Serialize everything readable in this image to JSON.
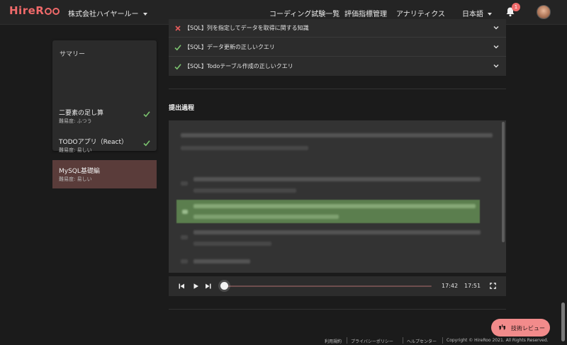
{
  "header": {
    "logo": "HireRoo",
    "company": "株式会社ハイヤールー",
    "nav": [
      "コーディング試験一覧",
      "評価指標管理",
      "アナリティクス"
    ],
    "language": "日本語",
    "notification_count": "1"
  },
  "summary": {
    "title": "サマリー",
    "items": [
      {
        "name": "二要素の足し算",
        "difficulty": "難易度: ふつう",
        "status": "passed"
      },
      {
        "name": "TODOアプリ（React）",
        "difficulty": "難易度: 易しい",
        "status": "passed"
      },
      {
        "name": "MySQL基礎編",
        "difficulty": "難易度: 易しい",
        "status": "selected"
      }
    ]
  },
  "questions": [
    {
      "label": "【SQL】列を指定してデータを取得に関する知識",
      "result": "incorrect"
    },
    {
      "label": "【SQL】データ更新の正しいクエリ",
      "result": "correct"
    },
    {
      "label": "【SQL】Todoテーブル作成の正しいクエリ",
      "result": "correct"
    }
  ],
  "submission": {
    "title": "提出過程"
  },
  "player": {
    "current_time": "17:42",
    "total_time": "17:51",
    "progress": 0.0
  },
  "review_button": "技術レビュー",
  "footer": {
    "links": [
      "利用規約",
      "プライバシーポリシー",
      "ヘルプセンター"
    ],
    "copyright": "Copyright © HireRoo 2021. All Rights Reserved."
  },
  "colors": {
    "brand": "#f06a6a",
    "correct": "#7cc46f",
    "incorrect": "#e85c5c",
    "selected_row": "#5a3c3a",
    "highlight": "#5b7e4e"
  },
  "icons": [
    "bell-icon",
    "check-icon",
    "cross-icon",
    "chevron-down-icon",
    "skip-back-icon",
    "play-icon",
    "skip-forward-icon",
    "fullscreen-icon",
    "review-icon"
  ]
}
